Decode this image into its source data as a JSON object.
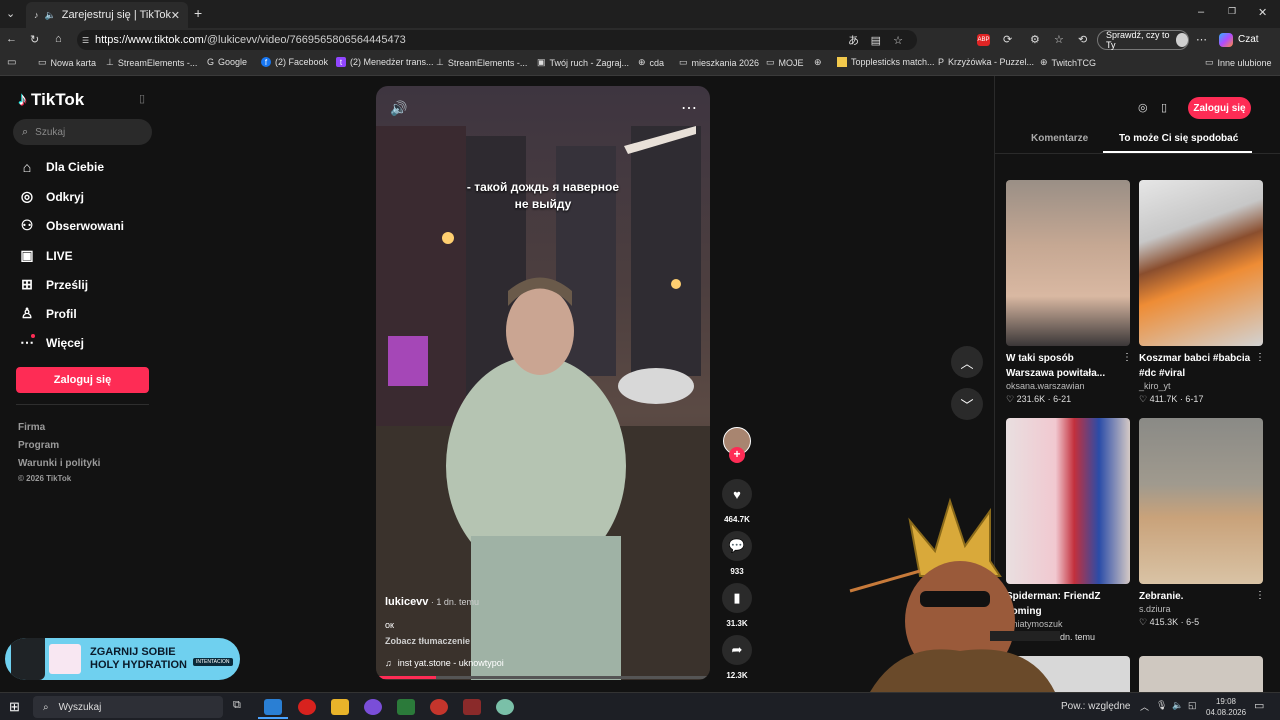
{
  "browser": {
    "tab_title": "Zarejestruj się | TikTok",
    "url_host": "https://www.tiktok.com",
    "url_path": "/@lukicevv/video/7669565806564445473",
    "profile_button": "Sprawdź, czy to Ty",
    "copilot": "Czat",
    "bookmarks": [
      "Nowa karta",
      "StreamElements -...",
      "Google",
      "(2) Facebook",
      "(2) Menedżer trans...",
      "StreamElements -...",
      "Twój ruch - Zagraj...",
      "cda",
      "mieszkania 2026",
      "MOJE",
      "Topplesticks match...",
      "Krzyżówka - Puzzel...",
      "TwitchTCG"
    ],
    "other_bookmarks": "Inne ulubione"
  },
  "sidebar": {
    "logo": "TikTok",
    "search_placeholder": "Szukaj",
    "items": [
      "Dla Ciebie",
      "Odkryj",
      "Obserwowani",
      "LIVE",
      "Prześlij",
      "Profil",
      "Więcej"
    ],
    "login": "Zaloguj się",
    "footer": [
      "Firma",
      "Program",
      "Warunki i polityki",
      "© 2026 TikTok"
    ]
  },
  "video": {
    "caption_line1": "- такой дождь я наверное",
    "caption_line2": "не выйду",
    "author": "lukicevv",
    "time": " · 1 dn. temu",
    "description": "ок",
    "translate": "Zobacz tłumaczenie",
    "music": "inst yat.stone - uknowtypoi"
  },
  "actions": {
    "likes": "464.7K",
    "comments": "933",
    "saves": "31.3K",
    "shares": "12.3K"
  },
  "right": {
    "login": "Zaloguj się",
    "tabs": [
      "Komentarze",
      "To może Ci się spodobać"
    ],
    "cards": [
      {
        "title1": "W taki sposób",
        "title2": "Warszawa powitała...",
        "user": "oksana.warszawian",
        "stats": "231.6K · 6-21"
      },
      {
        "title1": "Koszmar babci #babcia",
        "title2": "#dc #viral",
        "user": "_kiro_yt",
        "stats": "411.7K · 6-17"
      },
      {
        "title1": "Spiderman: FriendZ",
        "title2": "coming",
        "user": "kiniatymoszuk",
        "stats": "112.1K · 5 dn. temu"
      },
      {
        "title1": "Zebranie.",
        "title2": "",
        "user": "s.dziura",
        "stats": "415.3K · 6-5"
      }
    ]
  },
  "ad": {
    "line1": "ZGARNIJ SOBIE",
    "line2": "HOLY HYDRATION",
    "badge": "INTENTACION"
  },
  "taskbar": {
    "search": "Wyszukaj",
    "weather": "Pow.: względne",
    "time": "19:08",
    "date": "04.08.2026"
  },
  "colors": {
    "accent": "#fe2c55",
    "background": "#121212"
  }
}
